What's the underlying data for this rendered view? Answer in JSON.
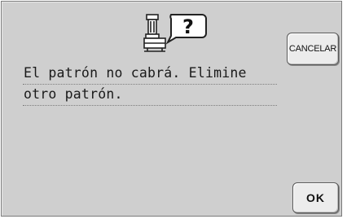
{
  "dialog": {
    "icon": "embroidery-machine-question-icon",
    "message_lines": [
      "El patrón no cabrá. Elimine",
      "otro patrón."
    ],
    "cancel_label": "CANCELAR",
    "ok_label": "OK"
  },
  "colors": {
    "panel_background": "#cfcfcf",
    "button_background": "#ececec",
    "text": "#1a1a1a"
  }
}
